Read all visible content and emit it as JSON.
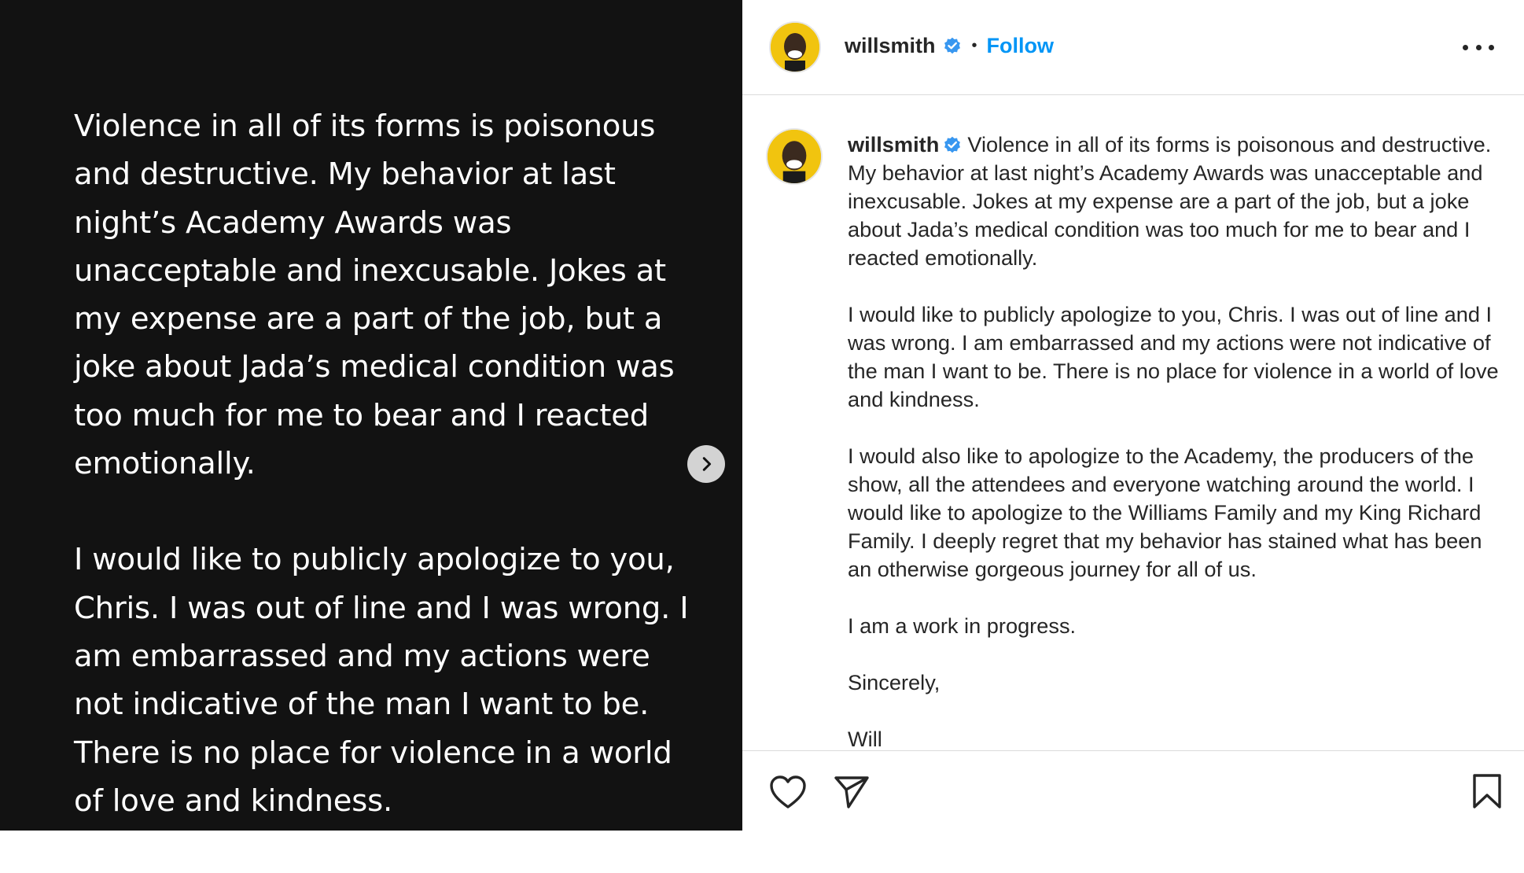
{
  "media": {
    "paragraphs": [
      "Violence in all of its forms is poisonous and destructive. My behavior at last night’s Academy Awards was unacceptable and inexcusable. Jokes at my expense are a part of the job, but a joke about Jada’s medical condition was too much for me to bear and I reacted emotionally.",
      "I would like to publicly apologize to you, Chris. I was out of line and I was wrong. I am embarrassed and my actions were not indicative of the man I want to be. There is no place for violence in a world of love and kindness."
    ],
    "next_icon": "chevron-right-icon"
  },
  "header": {
    "username": "willsmith",
    "separator": "•",
    "follow_label": "Follow",
    "more_icon": "more-options-icon"
  },
  "caption": {
    "username": "willsmith",
    "intro": "Violence in all of its forms is poisonous and destructive. My behavior at last night’s Academy Awards was unacceptable and inexcusable. Jokes at my expense are a part of the job, but a joke about Jada’s medical condition was too much for me to bear and I reacted emotionally.",
    "p2": "I would like to publicly apologize to you, Chris. I was out of line and I was wrong. I am embarrassed and my actions were not indicative of the man I want to be. There is no place for violence in a world of love and kindness.",
    "p3": "I would also like to apologize to the Academy, the producers of the show, all the attendees and everyone watching around the world. I would like to apologize to the Williams Family and my King Richard Family. I deeply regret that my behavior has stained what has been an otherwise gorgeous journey for all of us.",
    "p4": "I am a work in progress.",
    "p5": "Sincerely,",
    "p6": "Will"
  },
  "actions": {
    "icons": [
      "heart-icon",
      "share-icon",
      "bookmark-icon"
    ]
  },
  "colors": {
    "media_bg": "#121212",
    "link": "#0095f6",
    "verified": "#3897f0",
    "avatar_bg": "#f1c40f"
  }
}
